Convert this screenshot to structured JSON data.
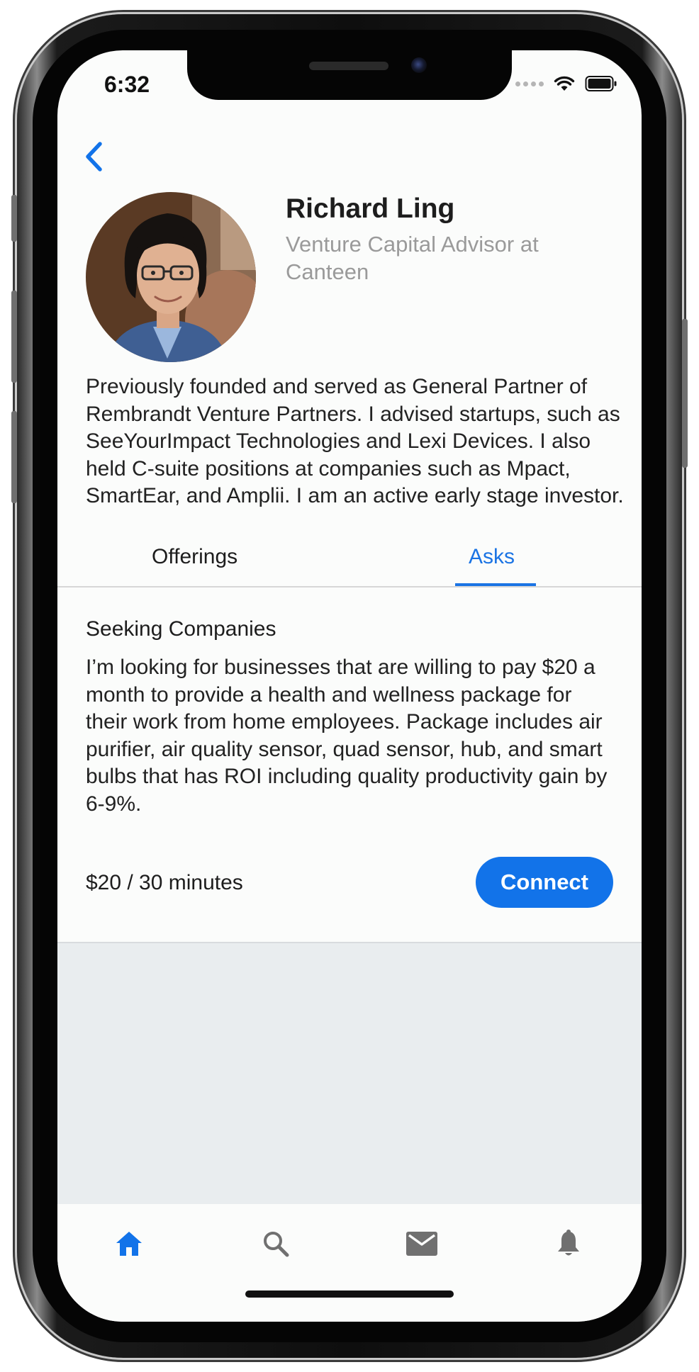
{
  "status_bar": {
    "time": "6:32"
  },
  "profile": {
    "name": "Richard Ling",
    "title": "Venture Capital Advisor at Canteen",
    "bio": "Previously founded and served as General Partner of Rembrandt Venture Partners. I advised startups, such as SeeYourImpact Technologies and Lexi Devices. I also held C-suite positions at companies such as Mpact, SmartEar, and Amplii. I am an active early stage investor."
  },
  "tabs": [
    {
      "label": "Offerings",
      "active": false
    },
    {
      "label": "Asks",
      "active": true
    }
  ],
  "ask_card": {
    "heading": "Seeking Companies",
    "description": "I’m looking for businesses that are willing to pay $20 a month to provide a health and wellness package for their work from home employees. Package includes air purifier, air quality sensor, quad sensor, hub, and smart bulbs that has ROI including quality productivity gain by 6-9%.",
    "price": "$20 / 30 minutes",
    "connect_label": "Connect"
  },
  "bottom_nav": [
    {
      "icon": "home-icon",
      "active": true
    },
    {
      "icon": "search-icon",
      "active": false
    },
    {
      "icon": "mail-icon",
      "active": false
    },
    {
      "icon": "bell-icon",
      "active": false
    }
  ],
  "colors": {
    "accent": "#1273e9",
    "tab_active": "#1b74e4",
    "nav_inactive": "#707070",
    "background": "#fbfcfb",
    "empty_area": "#e9edef"
  }
}
